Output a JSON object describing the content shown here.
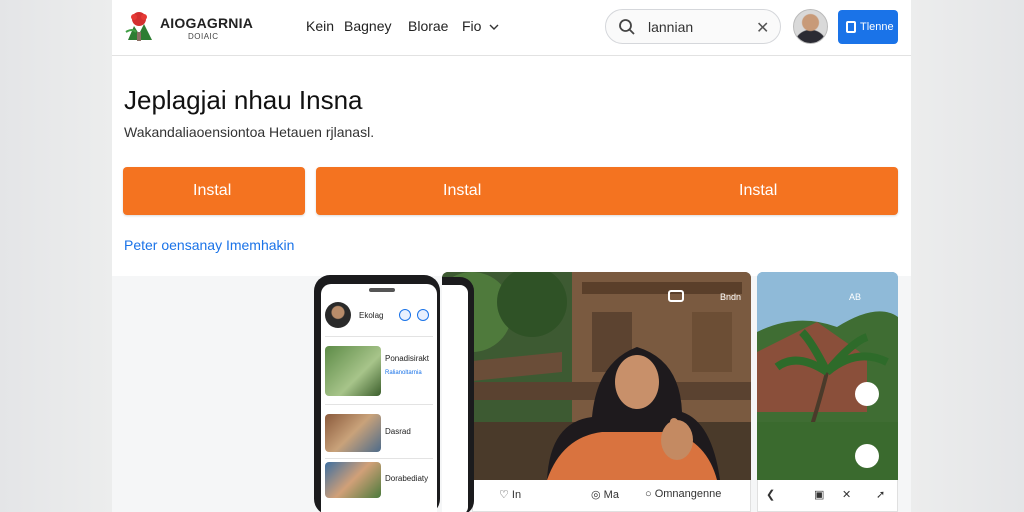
{
  "header": {
    "brand": "AIOGAGRNIA",
    "brand_sub": "DOIAIC",
    "nav": [
      {
        "label": "Kein"
      },
      {
        "label": "Bagney"
      },
      {
        "label": "Blorae"
      },
      {
        "label": "Fio"
      }
    ],
    "search": {
      "value": "lannian"
    },
    "cta_label": "Tlenne"
  },
  "hero": {
    "title": "Jeplagjai nhau Insna",
    "subtitle": "Wakandaliaoensiontoa Hetauen rjlanasl.",
    "buttons": [
      "Instal",
      "Instal",
      "Instal"
    ],
    "link": "Peter oensanay Imemhakin"
  },
  "phone": {
    "name": "Ekolag",
    "items": [
      {
        "title": "Ponadisirakt",
        "sub": "Ralianoltarnia"
      },
      {
        "title": "Dasrad",
        "sub": ""
      },
      {
        "title": "Dorabediaty",
        "sub": ""
      }
    ]
  },
  "main_card": {
    "overlay_label": "Bndn",
    "toolbar": [
      "In",
      "Ma",
      "Omnangenne"
    ]
  },
  "side_card": {
    "overlay_label": "AB"
  },
  "colors": {
    "accent_orange": "#f47320",
    "link_blue": "#1a73e8"
  }
}
